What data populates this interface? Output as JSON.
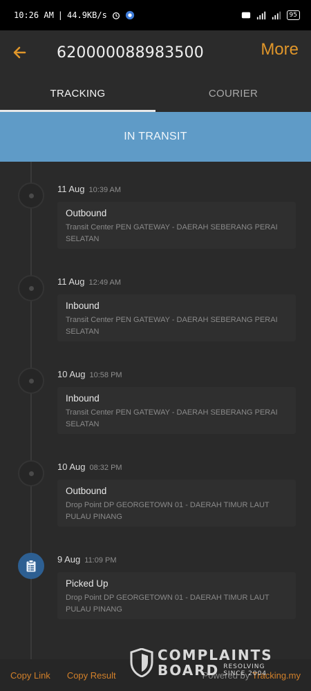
{
  "status_bar": {
    "time": "10:26 AM",
    "speed": "44.9KB/s",
    "battery": "95"
  },
  "app_bar": {
    "title": "620000088983500",
    "more_label": "More"
  },
  "tabs": [
    {
      "label": "TRACKING",
      "active": true
    },
    {
      "label": "COURIER",
      "active": false
    }
  ],
  "banner": {
    "text": "IN TRANSIT",
    "color": "#5f9bc7"
  },
  "events": [
    {
      "date": "11 Aug",
      "time": "10:39 AM",
      "status": "Outbound",
      "detail": "Transit Center PEN GATEWAY - DAERAH SEBERANG PERAI SELATAN"
    },
    {
      "date": "11 Aug",
      "time": "12:49 AM",
      "status": "Inbound",
      "detail": "Transit Center PEN GATEWAY - DAERAH SEBERANG PERAI SELATAN"
    },
    {
      "date": "10 Aug",
      "time": "10:58 PM",
      "status": "Inbound",
      "detail": "Transit Center PEN GATEWAY - DAERAH SEBERANG PERAI SELATAN"
    },
    {
      "date": "10 Aug",
      "time": "08:32 PM",
      "status": "Outbound",
      "detail": "Drop Point DP GEORGETOWN 01 - DAERAH TIMUR LAUT PULAU PINANG"
    },
    {
      "date": "9 Aug",
      "time": "11:09 PM",
      "status": "Picked Up",
      "detail": "Drop Point DP GEORGETOWN 01 - DAERAH TIMUR LAUT PULAU PINANG",
      "icon": "clipboard-icon"
    }
  ],
  "footer": {
    "copy_link": "Copy Link",
    "copy_result": "Copy Result",
    "powered_by": "Powered by",
    "brand": "Tracking.my"
  },
  "watermark": {
    "line1": "COMPLAINTS",
    "line2": "BOARD",
    "tagline1": "RESOLVING",
    "tagline2": "SINCE 2004"
  },
  "colors": {
    "accent": "#e0962a",
    "active_node": "#2d5f92"
  }
}
